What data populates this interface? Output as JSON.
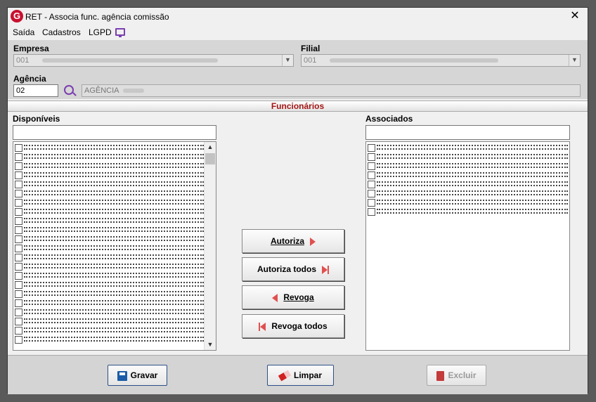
{
  "window": {
    "title": "RET - Associa func. agência comissão",
    "logo_letter": "G"
  },
  "menu": {
    "items": [
      "Saída",
      "Cadastros",
      "LGPD"
    ]
  },
  "form": {
    "empresa_label": "Empresa",
    "empresa_value": "001",
    "filial_label": "Filial",
    "filial_value": "001",
    "agencia_label": "Agência",
    "agencia_code": "02",
    "agencia_name": "AGÊNCIA"
  },
  "section": {
    "title": "Funcionários"
  },
  "lists": {
    "disponiveis_label": "Disponíveis",
    "disponiveis_search": "",
    "disponiveis_row_count": 22,
    "associados_label": "Associados",
    "associados_search": "",
    "associados_row_count": 8
  },
  "actions": {
    "autoriza": "Autoriza",
    "autoriza_todos": "Autoriza todos",
    "revoga": "Revoga",
    "revoga_todos": "Revoga todos"
  },
  "footer": {
    "gravar": "Gravar",
    "limpar": "Limpar",
    "excluir": "Excluir"
  },
  "colors": {
    "accent_purple": "#7b3fb0",
    "header_red": "#a31515",
    "arrow_red": "#e05050"
  }
}
